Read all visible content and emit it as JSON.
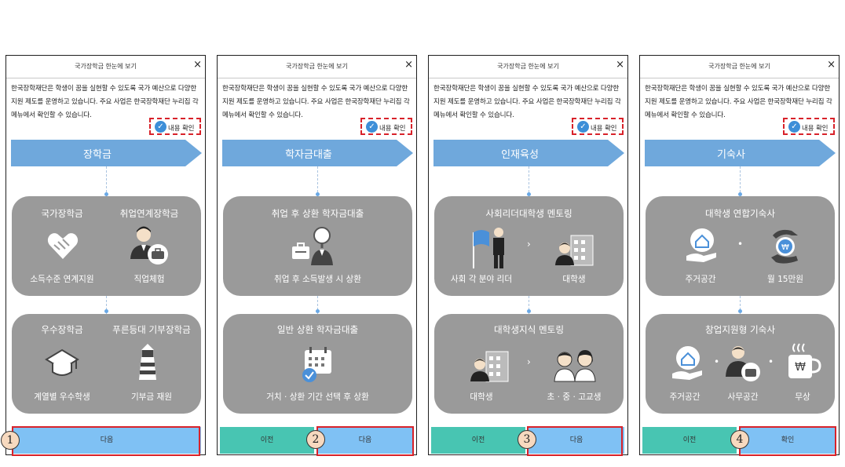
{
  "dialog_title": "국가장학금 한눈에 보기",
  "close_glyph": "×",
  "description": "한국장학재단은 학생이 꿈을 실현할 수 있도록 국가 예산으로 다양한 지원 제도를 운영하고 있습니다. 주요 사업은 한국장학재단 누리집 각 메뉴에서 확인할 수 있습니다.",
  "confirm_label": "내용 확인",
  "prev_label": "이전",
  "next_label": "다음",
  "ok_label": "확인",
  "arrow_glyph": "›",
  "dot_glyph": "•",
  "step_numbers": [
    "1",
    "2",
    "3",
    "4"
  ],
  "colors": {
    "banner": "#6fa8dc",
    "card": "#9a9a9a",
    "prev": "#48c5b2",
    "next": "#7fc1f4",
    "highlight": "#d8222a"
  },
  "panels": [
    {
      "banner": "장학금",
      "card1": {
        "left_title": "국가장학금",
        "right_title": "취업연계장학금",
        "left_sub": "소득수준 연계지원",
        "right_sub": "직업체험"
      },
      "card2": {
        "left_title": "우수장학금",
        "right_title": "푸른등대 기부장학금",
        "left_sub": "계열별 우수학생",
        "right_sub": "기부금 재원"
      }
    },
    {
      "banner": "학자금대출",
      "card1": {
        "title": "취업 후 상환 학자금대출",
        "sub": "취업 후 소득발생 시 상환"
      },
      "card2": {
        "title": "일반 상환 학자금대출",
        "sub": "거치 · 상환 기간 선택 후 상환"
      }
    },
    {
      "banner": "인재육성",
      "card1": {
        "title": "사회리더대학생 멘토링",
        "left_sub": "사회 각 분야 리더",
        "right_sub": "대학생"
      },
      "card2": {
        "title": "대학생지식 멘토링",
        "left_sub": "대학생",
        "right_sub": "초 · 중 · 고교생"
      }
    },
    {
      "banner": "기숙사",
      "card1": {
        "title": "대학생 연합기숙사",
        "left_sub": "주거공간",
        "right_sub": "월 15만원"
      },
      "card2": {
        "title": "창업지원형 기숙사",
        "sub1": "주거공간",
        "sub2": "사무공간",
        "sub3": "무상"
      }
    }
  ]
}
